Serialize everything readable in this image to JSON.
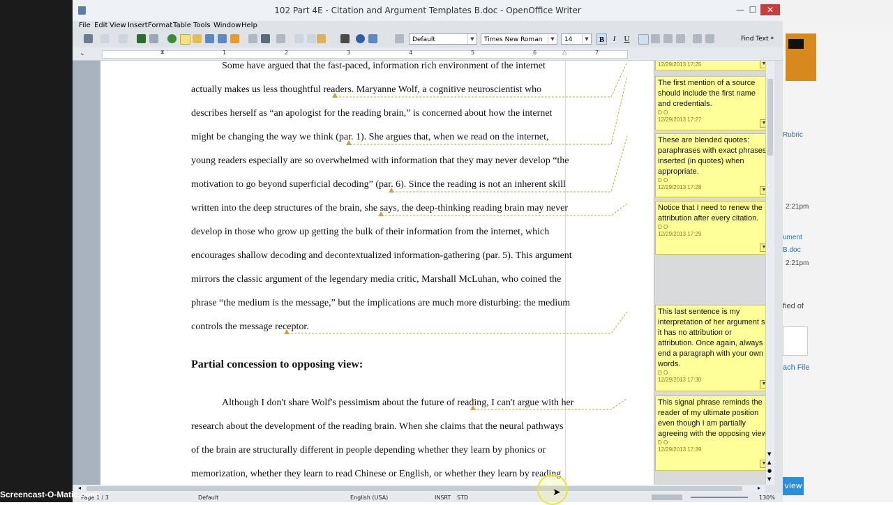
{
  "window": {
    "title": "102 Part 4E - Citation and Argument Templates B.doc - OpenOffice Writer",
    "minimize_glyph": "—",
    "maximize_glyph": "☐",
    "close_glyph": "✕"
  },
  "menu": [
    "File",
    "Edit",
    "View",
    "Insert",
    "Format",
    "Table",
    "Tools",
    "Window",
    "Help"
  ],
  "toolbar": {
    "paragraph_style": "Default",
    "font_name": "Times New Roman",
    "font_size": "14",
    "bold": "B",
    "italic": "I",
    "underline": "U",
    "find_text": "Find Text"
  },
  "ruler_numbers": [
    "1",
    "2",
    "3",
    "4",
    "5",
    "6",
    "7"
  ],
  "document": {
    "lines": [
      "Some have argued that the fast-paced, information rich environment of the internet",
      "actually makes us less thoughtful readers. Maryanne Wolf, a cognitive neuroscientist who",
      "describes herself as “an apologist for the reading brain,” is concerned about how the internet",
      "might be changing the way we think (par. 1). She argues that, when we read on the internet,",
      "young readers especially are so overwhelmed with information that they may never develop “the",
      "motivation to go beyond superficial decoding” (par. 6). Since the reading is not an inherent skill",
      "written into the deep structures of the brain, she says, the deep-thinking reading brain may never",
      "develop in those who grow up getting the bulk of their information from the internet, which",
      "encourages shallow decoding and decontextualized information-gathering (par. 5). This argument",
      "mirrors the classic argument of the legendary media critic, Marshall McLuhan, who coined the",
      "phrase “the medium is the message,” but the implications are much more disturbing: the medium",
      "controls the message receptor."
    ],
    "heading": "Partial concession to opposing view:",
    "lines2": [
      "Although I don't share Wolf's pessimism about the future of reading, I can't argue with her",
      "research about the development of the reading brain. When she claims that the neural pathways",
      "of the brain are structurally different in people depending whether they learn by phonics or",
      "memorization, whether they learn to read Chinese or English, or whether they learn by reading"
    ]
  },
  "comments": [
    {
      "text": "",
      "author": "",
      "date": "12/29/2013 17:25"
    },
    {
      "text": "The first mention of a source should include the first name and credentials.",
      "author": "D O",
      "date": "12/29/2013 17:27"
    },
    {
      "text": "These are blended quotes: paraphrases with exact phrases inserted (in quotes) when appropriate.",
      "author": "D O",
      "date": "12/29/2013 17:28"
    },
    {
      "text": "Notice that I need to renew the attribution after every citation.",
      "author": "D O",
      "date": "12/29/2013 17:29"
    },
    {
      "text": "This last sentence is my interpretation of her argument so it has no attribution or attribution. Once again, always end a paragraph with your own words.",
      "author": "D O",
      "date": "12/29/2013 17:30"
    },
    {
      "text": "This signal phrase reminds the reader of my ultimate position even though I am partially agreeing with the opposing view.",
      "author": "D O",
      "date": "12/29/2013 17:39"
    }
  ],
  "status": {
    "page": "Page 1 / 3",
    "style": "Default",
    "language": "English (USA)",
    "insert": "INSRT",
    "selection": "STD",
    "zoom": "130%"
  },
  "background": {
    "watermark": "Screencast-O-Matic.com",
    "items": [
      "Rubric",
      "2:21pm",
      "ument",
      "B.doc",
      "2:21pm",
      "fied of",
      "ach File",
      "view"
    ]
  }
}
